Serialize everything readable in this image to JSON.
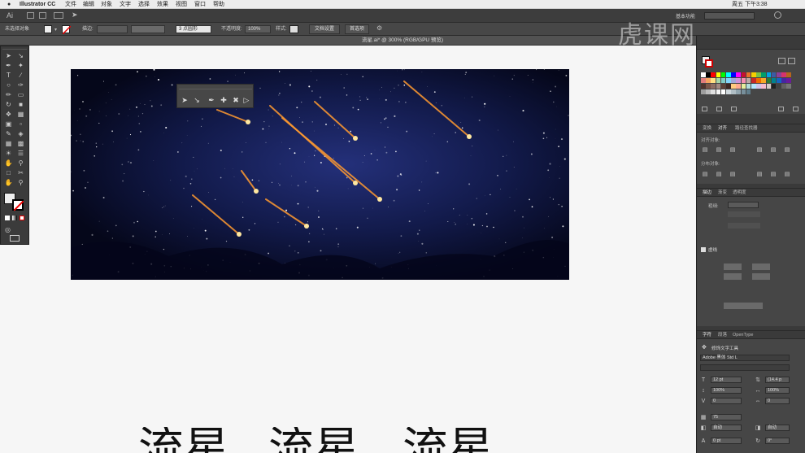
{
  "menubar": {
    "apple": "",
    "app_name": "Illustrator CC",
    "items": [
      "文件",
      "编辑",
      "对象",
      "文字",
      "选择",
      "效果",
      "视图",
      "窗口",
      "帮助"
    ],
    "workspace": "基本功能",
    "clock": "周五 下午3:38"
  },
  "appbar": {
    "logo": "Ai"
  },
  "controlbar": {
    "selection": "未选择对象",
    "stroke_label": "描边:",
    "brush": "3 点圆形",
    "opacity_label": "不透明度:",
    "opacity_value": "100%",
    "style_label": "样式:",
    "doc_setup": "文档设置",
    "preferences": "首选项"
  },
  "document": {
    "tab_title": "流星.ai* @ 300% (RGB/GPU 预览)"
  },
  "watermark": "虎课网",
  "right_panel": {
    "align": {
      "tabs": [
        "变换",
        "对齐",
        "路径查找器"
      ],
      "active": 1,
      "row1": "对齐对象:",
      "row2": "分布对象:"
    },
    "stroke": {
      "tabs": [
        "描边",
        "渐变",
        "透明度"
      ],
      "active": 0,
      "weight_label": "粗细:",
      "section_label": "虚线"
    },
    "character": {
      "tabs": [
        "字符",
        "段落",
        "OpenType"
      ],
      "active": 0,
      "tool": "修饰文字工具",
      "font": "Adobe 黑体 Std L",
      "size": "12 pt",
      "leading": "(14.4 p",
      "hscale": "100%",
      "vscale": "100%",
      "tracking": "0",
      "kerning": "0",
      "tsume": "75",
      "auto1": "自动",
      "auto2": "自动",
      "baseline": "0 pt",
      "rotate": "0°"
    }
  },
  "canvas_text": [
    "流星",
    "流星",
    "流星"
  ],
  "colors": {
    "menubar": "#ececec",
    "appbar": "#3d3d3d",
    "panel": "#3a3a3a",
    "canvas": "#f6f6f6",
    "sky": "#0a0d2a",
    "meteor": "#ffb040"
  }
}
